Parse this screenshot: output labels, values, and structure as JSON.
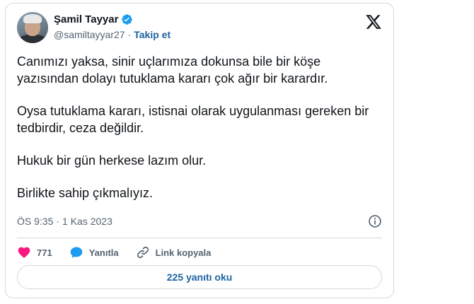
{
  "author": {
    "name": "Şamil Tayyar",
    "handle": "@samiltayyar27",
    "separator": "·",
    "follow_label": "Takip et",
    "verified_color": "#1d9bf0"
  },
  "icons": {
    "brand": "x-logo-icon",
    "verified": "verified-badge-icon",
    "info": "info-icon",
    "like": "heart-icon",
    "reply": "speech-bubble-icon",
    "link": "link-icon"
  },
  "tweet": {
    "paragraphs": [
      "Canımızı yaksa, sinir uçlarımıza dokunsa bile bir köşe yazısından dolayı tutuklama kararı çok ağır bir karardır.",
      "Oysa tutuklama kararı, istisnai olarak uygulanması gereken bir tedbirdir, ceza değildir.",
      "Hukuk bir gün herkese lazım olur.",
      "Birlikte sahip çıkmalıyız."
    ],
    "time": "ÖS 9:35",
    "separator": "·",
    "date": "1 Kas 2023"
  },
  "actions": {
    "like_count": "771",
    "reply_label": "Yanıtla",
    "copy_link_label": "Link kopyala"
  },
  "footer": {
    "read_replies_label": "225 yanıtı oku"
  },
  "colors": {
    "accent": "#1d63a3",
    "like": "#f91880",
    "reply": "#1d9bf0",
    "muted": "#536471",
    "border": "#cfd9de"
  }
}
